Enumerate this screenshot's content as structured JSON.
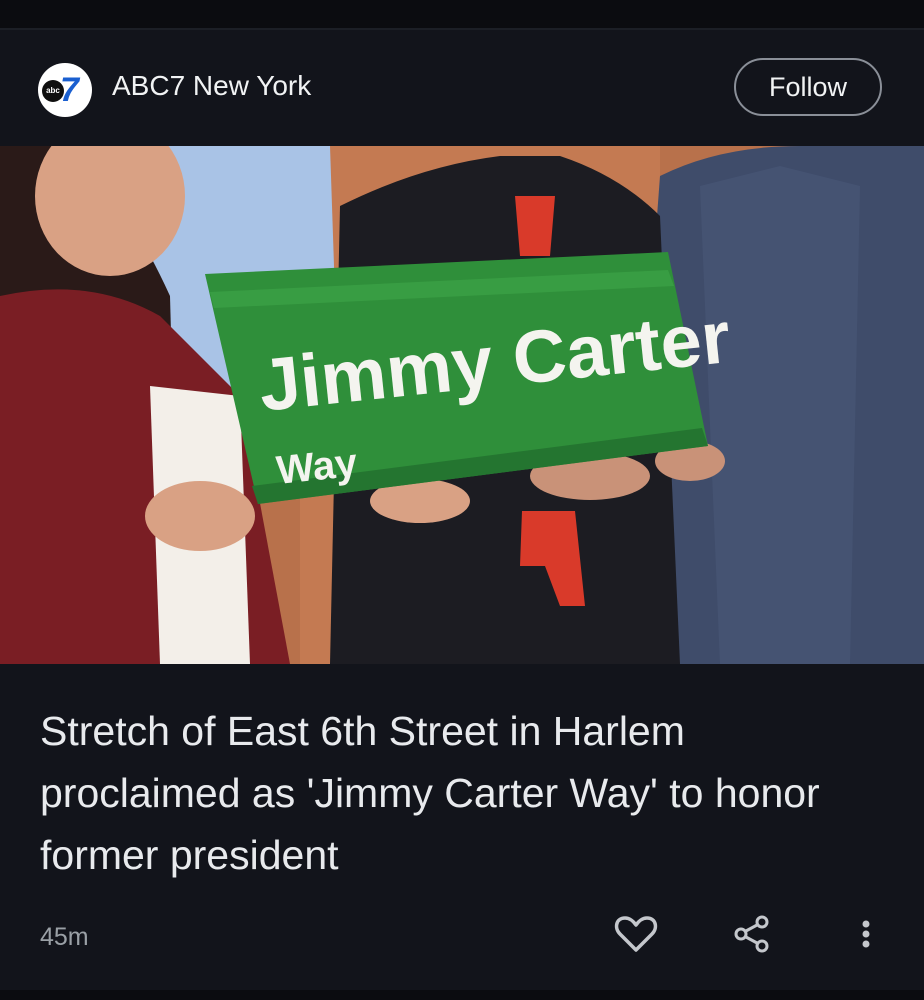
{
  "article": {
    "source_name": "ABC7 New York",
    "logo_text": "abc",
    "logo_number": "7",
    "follow_label": "Follow",
    "headline": "Stretch of East 6th Street in Harlem proclaimed as 'Jimmy Carter Way' to honor former president",
    "time_ago": "45m",
    "image": {
      "sign_line1": "Jimmy Carter",
      "sign_line2": "Way"
    },
    "actions": {
      "like_icon": "heart-icon",
      "share_icon": "share-icon",
      "more_icon": "more-vert-icon"
    }
  },
  "colors": {
    "background": "#0d0f14",
    "card": "#12141b",
    "text": "#e8eaed",
    "muted": "#9aa0a6",
    "sign_green": "#2f8f3a"
  }
}
